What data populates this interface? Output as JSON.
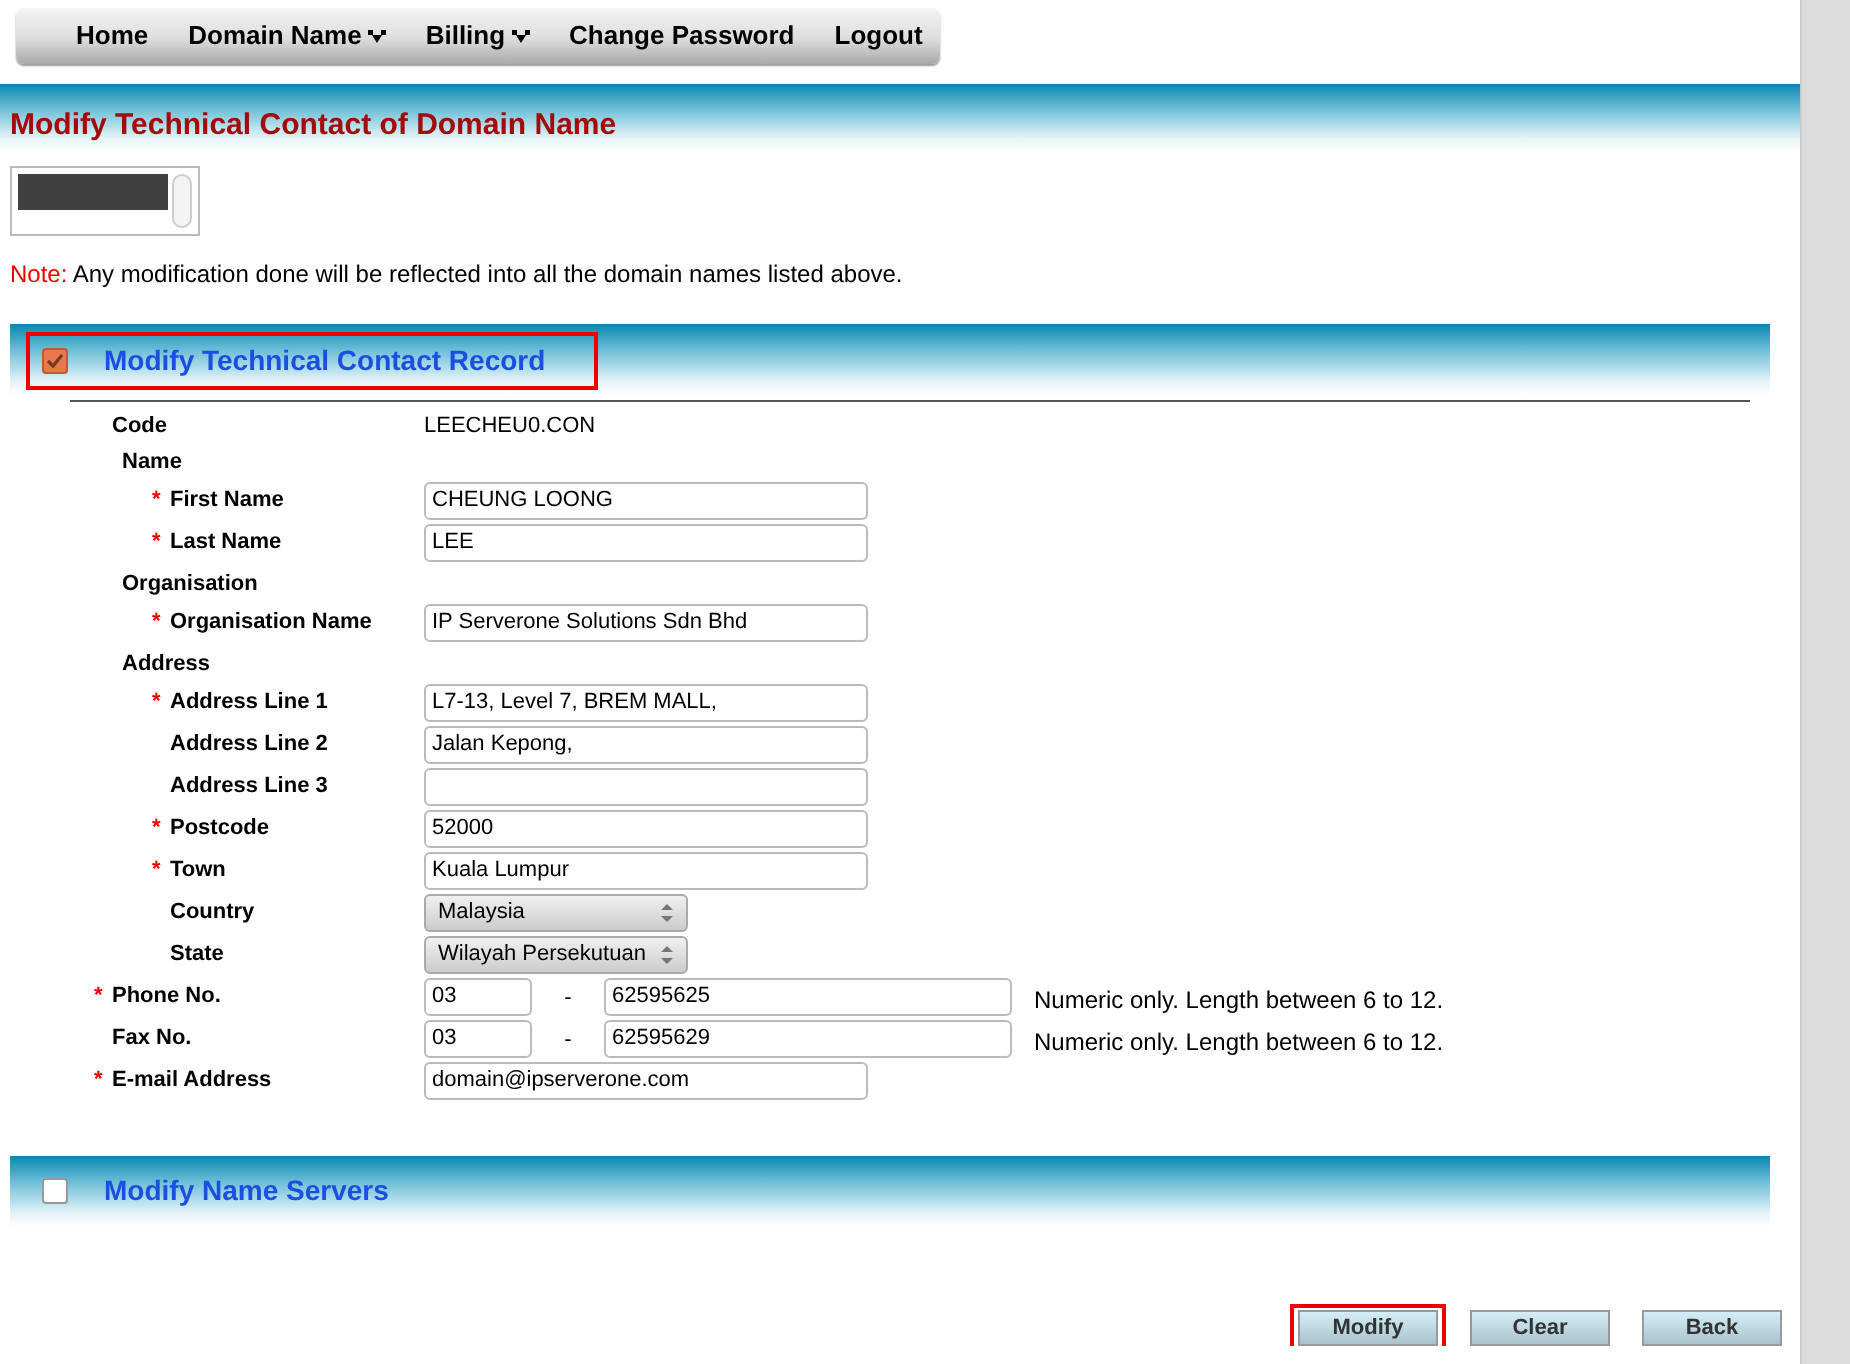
{
  "menu": [
    {
      "label": "Home",
      "dropdown": false
    },
    {
      "label": "Domain Name",
      "dropdown": true
    },
    {
      "label": "Billing",
      "dropdown": true
    },
    {
      "label": "Change Password",
      "dropdown": false
    },
    {
      "label": "Logout",
      "dropdown": false
    }
  ],
  "page_title": "Modify Technical Contact of Domain Name",
  "note": {
    "prefix": "Note:",
    "text": "Any modification done will be reflected into all the domain names listed above."
  },
  "sections": [
    {
      "title": "Modify Technical Contact Record",
      "checked": true,
      "highlighted": true,
      "rows": [
        {
          "kind": "text",
          "label": "Code",
          "value": "LEECHEU0.CON"
        },
        {
          "kind": "group",
          "label": "Name",
          "children": [
            {
              "kind": "input",
              "marker": "*",
              "label": "First Name",
              "value": "CHEUNG LOONG"
            },
            {
              "kind": "input",
              "marker": "*",
              "label": "Last Name",
              "value": "LEE"
            }
          ]
        },
        {
          "kind": "group",
          "label": "Organisation",
          "children": [
            {
              "kind": "input",
              "marker": "*",
              "label": "Organisation Name",
              "value": "IP Serverone Solutions Sdn Bhd"
            }
          ]
        },
        {
          "kind": "group",
          "label": "Address",
          "children": [
            {
              "kind": "input",
              "marker": "*",
              "label": "Address Line 1",
              "value": "L7-13, Level 7, BREM MALL,"
            },
            {
              "kind": "input",
              "label": "Address Line 2",
              "value": "Jalan Kepong,"
            },
            {
              "kind": "input",
              "label": "Address Line 3"
            },
            {
              "kind": "input",
              "marker": "*",
              "label": "Postcode",
              "value": "52000"
            },
            {
              "kind": "input",
              "marker": "*",
              "label": "Town",
              "value": "Kuala Lumpur"
            },
            {
              "kind": "select",
              "label": "Country",
              "value": "Malaysia"
            },
            {
              "kind": "select",
              "label": "State",
              "value": "Wilayah Persekutuan"
            }
          ]
        },
        {
          "kind": "phone",
          "marker": "*",
          "label": "Phone No.",
          "area": "03",
          "separator": "-",
          "number": "62595625",
          "hint": "Numeric only. Length between 6 to 12."
        },
        {
          "kind": "phone",
          "label": "Fax No.",
          "area": "03",
          "separator": "-",
          "number": "62595629",
          "hint": "Numeric only. Length between 6 to 12."
        },
        {
          "kind": "input",
          "marker": "*",
          "label": "E-mail Address",
          "value": "domain@ipserverone.com"
        }
      ]
    },
    {
      "title": "Modify Name Servers",
      "checked": false,
      "highlighted": false
    }
  ],
  "buttons": [
    {
      "label": "Modify",
      "highlighted": true
    },
    {
      "label": "Clear",
      "highlighted": false
    },
    {
      "label": "Back",
      "highlighted": false
    }
  ]
}
